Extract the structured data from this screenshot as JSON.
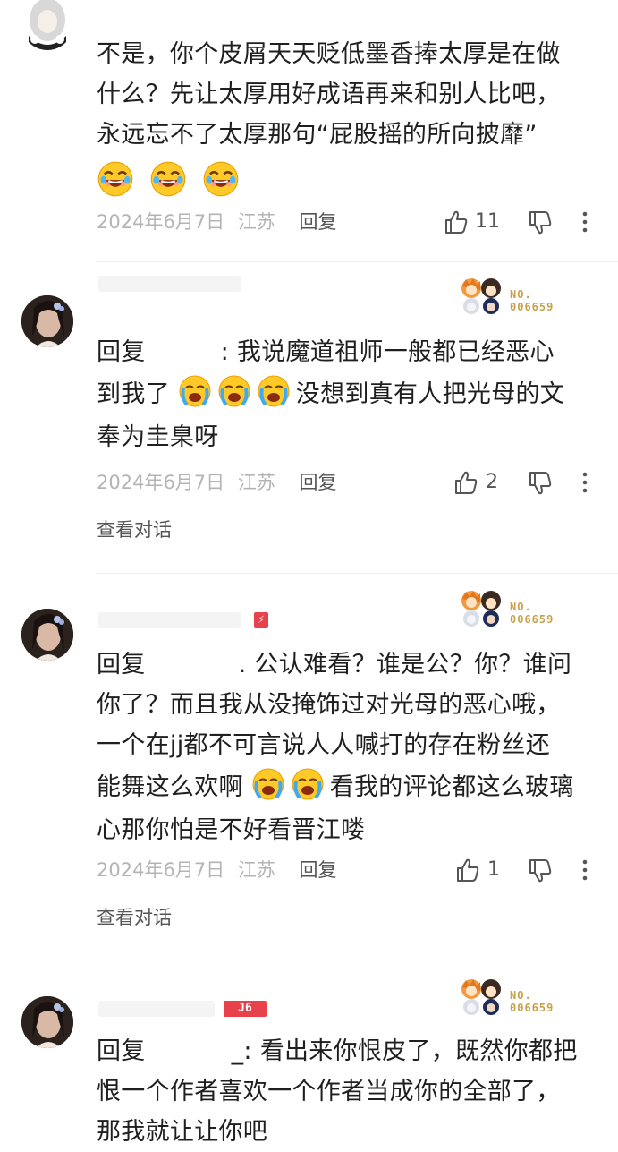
{
  "comments": [
    {
      "body_lines": [
        "不是，你个皮屑天天贬低墨香捧太厚是在做",
        "什么？先让太厚用好成语再来和别人比吧，",
        "永远忘不了太厚那句“屁股摇的所向披靡”"
      ],
      "date": "2024年6月7日",
      "location": "江苏",
      "reply_label": "回复",
      "likes": "11"
    },
    {
      "badge_no": "NO.",
      "badge_id": "006659",
      "reply_prefix": "回复",
      "line1_rest": ": 我说魔道祖师一般都已经恶心",
      "line2_a": "到我了",
      "line2_b": "没想到真有人把光母的文",
      "line3": "奉为圭臬呀",
      "date": "2024年6月7日",
      "location": "江苏",
      "reply_label": "回复",
      "likes": "2",
      "view_conversation": "查看对话"
    },
    {
      "badge_no": "NO.",
      "badge_id": "006659",
      "reply_prefix": "回复",
      "line1_rest": ". 公认难看？谁是公？你？谁问",
      "line2": "你了？而且我从没掩饰过对光母的恶心哦，",
      "line3": "一个在jj都不可言说人人喊打的存在粉丝还",
      "line4_a": "能舞这么欢啊",
      "line4_b": "看我的评论都这么玻璃",
      "line5": "心那你怕是不好看晋江喽",
      "date": "2024年6月7日",
      "location": "江苏",
      "reply_label": "回复",
      "likes": "1",
      "view_conversation": "查看对话"
    },
    {
      "badge_no": "NO.",
      "badge_id": "006659",
      "level_tag": "J6",
      "reply_prefix": "回复",
      "line1_rest": "_: 看出来你恨皮了，既然你都把",
      "line2": "恨一个作者喜欢一个作者当成你的全部了，",
      "line3": "那我就让让你吧"
    }
  ],
  "colors": {
    "meta_gray": "#b4b4b4",
    "action_gray": "#555555",
    "badge_gold": "#c9a14a",
    "tag_red": "#e8414b"
  }
}
